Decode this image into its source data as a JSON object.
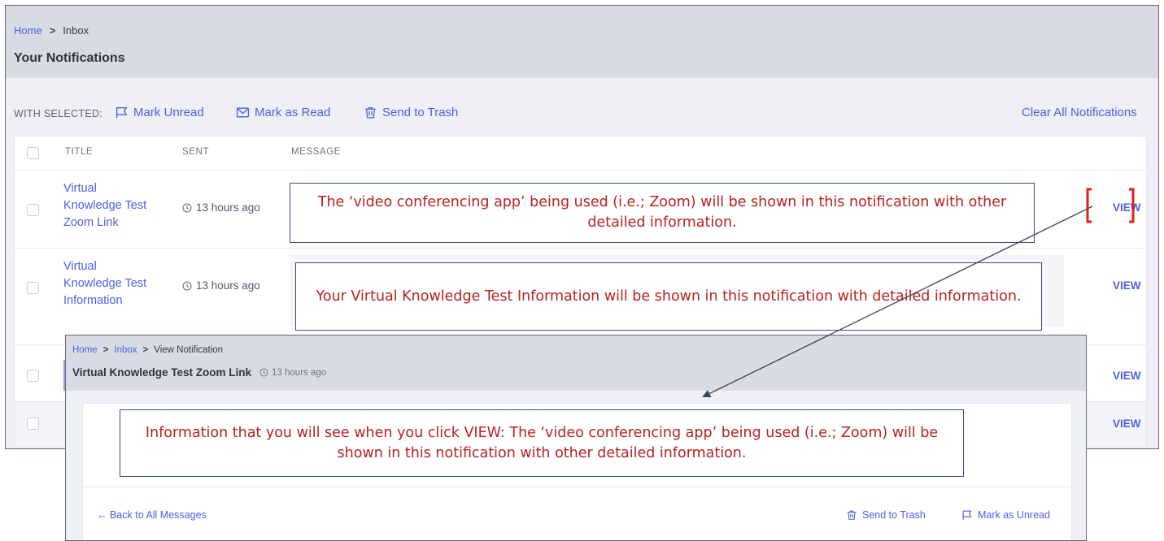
{
  "main": {
    "breadcrumb": {
      "home": "Home",
      "separator": ">",
      "current": "Inbox"
    },
    "title": "Your Notifications",
    "toolbar": {
      "with_selected": "WITH SELECTED:",
      "mark_unread": "Mark Unread",
      "mark_read": "Mark as Read",
      "send_trash": "Send to Trash",
      "clear_all": "Clear All Notifications"
    },
    "table": {
      "headers": [
        "TITLE",
        "SENT",
        "MESSAGE"
      ],
      "rows": [
        {
          "title_lines": [
            "Virtual",
            "Knowledge Test",
            "Zoom Link"
          ],
          "sent": "13 hours ago",
          "action": "VIEW"
        },
        {
          "title_lines": [
            "Virtual",
            "Knowledge Test",
            "Information"
          ],
          "sent": "13 hours ago",
          "action": "VIEW"
        },
        {
          "action": "VIEW"
        },
        {
          "action": "VIEW"
        }
      ]
    }
  },
  "callouts": {
    "zoom_link": "The ‘video conferencing app’ being used (i.e.; Zoom) will be shown in this notification with other detailed information.",
    "info": "Your Virtual Knowledge Test Information will be shown in this notification with detailed information.",
    "view": "Information that you will see when you click VIEW:  The ‘video conferencing app’ being used (i.e.; Zoom) will be shown in this notification with other detailed information."
  },
  "detail": {
    "breadcrumb": {
      "home": "Home",
      "separator": ">",
      "inbox": "Inbox",
      "current": "View Notification"
    },
    "title": "Virtual Knowledge Test Zoom Link",
    "sent": "13 hours ago",
    "back": "← Back to All Messages",
    "send_trash": "Send to Trash",
    "mark_unread": "Mark as Unread"
  },
  "colors": {
    "accent": "#4d5ee6",
    "callout_text": "#b8211e",
    "callout_border": "#3b4f78",
    "highlight_bracket": "#e0201b",
    "header_bg": "#d8dbe2",
    "page_bg": "#eef0f5"
  },
  "icons": [
    "flag-icon",
    "envelope-icon",
    "trash-icon",
    "clock-icon",
    "arrow-left-icon"
  ]
}
